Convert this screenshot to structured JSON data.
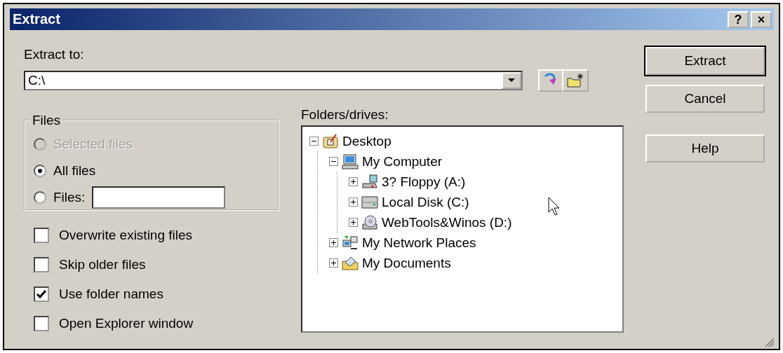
{
  "window": {
    "title": "Extract",
    "title_buttons": [
      "?",
      "×"
    ]
  },
  "extract_to": {
    "label": "Extract to:",
    "value": "C:\\"
  },
  "files_group": {
    "title": "Files",
    "options": [
      {
        "label": "Selected files",
        "selected": false,
        "disabled": true,
        "has_field": false
      },
      {
        "label": "All files",
        "selected": true,
        "disabled": false,
        "has_field": false
      },
      {
        "label": "Files:",
        "selected": false,
        "disabled": false,
        "has_field": true
      }
    ]
  },
  "checkboxes": [
    {
      "label": "Overwrite existing files",
      "checked": false
    },
    {
      "label": "Skip older files",
      "checked": false
    },
    {
      "label": "Use folder names",
      "checked": true
    },
    {
      "label": "Open Explorer window",
      "checked": false
    }
  ],
  "folders": {
    "label": "Folders/drives:",
    "tree": [
      {
        "label": "Desktop",
        "kind": "desktop",
        "expanded": true,
        "children": [
          {
            "label": "My Computer",
            "kind": "computer",
            "expanded": true,
            "children": [
              {
                "label": "3? Floppy (A:)",
                "kind": "floppy",
                "expanded": false
              },
              {
                "label": "Local Disk (C:)",
                "kind": "disk",
                "expanded": false
              },
              {
                "label": "WebTools&Winos (D:)",
                "kind": "cd",
                "expanded": false
              }
            ]
          },
          {
            "label": "My Network Places",
            "kind": "network",
            "expanded": false
          },
          {
            "label": "My Documents",
            "kind": "documents",
            "expanded": false
          }
        ]
      }
    ]
  },
  "buttons": [
    {
      "label": "Extract",
      "default": true
    },
    {
      "label": "Cancel",
      "default": false
    },
    {
      "label": "Help",
      "default": false
    }
  ]
}
